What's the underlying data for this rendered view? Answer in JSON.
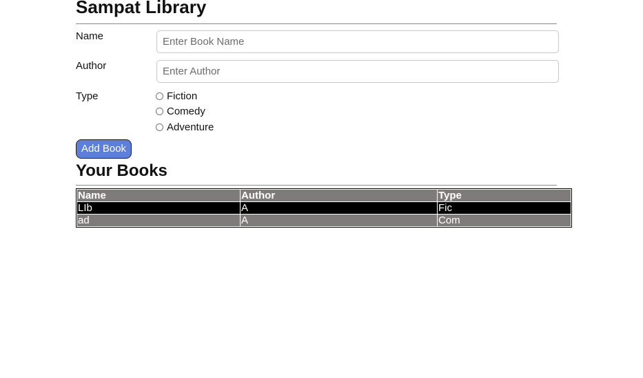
{
  "header": {
    "title": "Sampat Library"
  },
  "form": {
    "name_label": "Name",
    "name_placeholder": "Enter Book Name",
    "author_label": "Author",
    "author_placeholder": "Enter Author",
    "type_label": "Type",
    "types": [
      "Fiction",
      "Comedy",
      "Adventure"
    ],
    "submit_label": "Add Book"
  },
  "books_section": {
    "heading": "Your Books",
    "columns": [
      "Name",
      "Author",
      "Type"
    ],
    "rows": [
      [
        "LIb",
        "A",
        "Fic"
      ],
      [
        "ad",
        "A",
        "Com"
      ]
    ]
  },
  "colors": {
    "button": "#5b7fdb",
    "table_grey": "#7f7b7b",
    "table_dark": "#000000"
  }
}
